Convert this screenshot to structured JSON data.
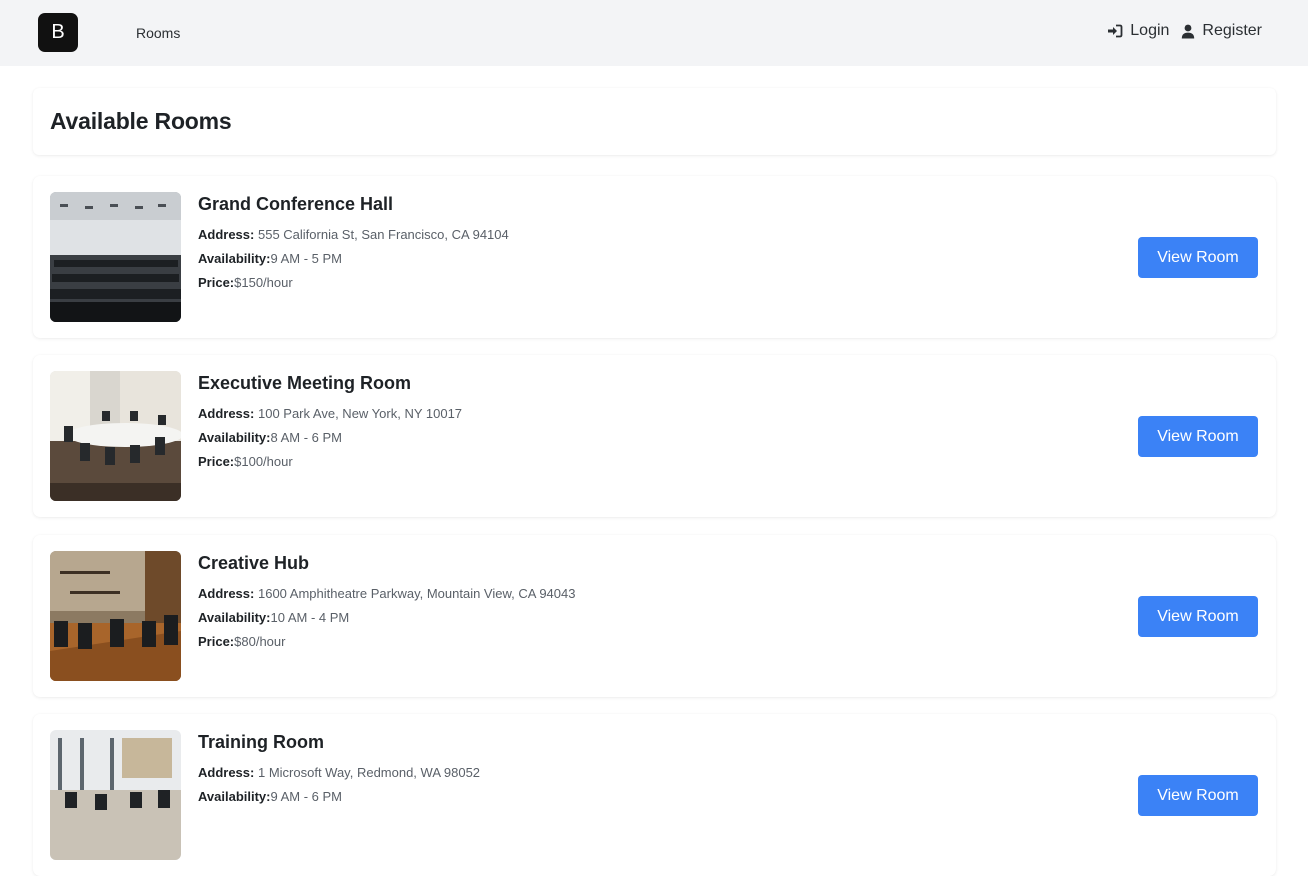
{
  "navbar": {
    "brand_letter": "B",
    "rooms_link": "Rooms",
    "login_label": "Login",
    "register_label": "Register"
  },
  "page": {
    "heading": "Available Rooms"
  },
  "labels": {
    "address": "Address:",
    "availability": "Availability:",
    "price": "Price:",
    "view_button": "View Room"
  },
  "rooms": [
    {
      "name": "Grand Conference Hall",
      "address": "555 California St, San Francisco, CA 94104",
      "availability": "9 AM - 5 PM",
      "price": "$150/hour"
    },
    {
      "name": "Executive Meeting Room",
      "address": "100 Park Ave, New York, NY 10017",
      "availability": "8 AM - 6 PM",
      "price": "$100/hour"
    },
    {
      "name": "Creative Hub",
      "address": "1600 Amphitheatre Parkway, Mountain View, CA 94043",
      "availability": "10 AM - 4 PM",
      "price": "$80/hour"
    },
    {
      "name": "Training Room",
      "address": "1 Microsoft Way, Redmond, WA 98052",
      "availability": "9 AM - 6 PM",
      "price": ""
    }
  ],
  "colors": {
    "accent": "#3b82f6",
    "navbar_bg": "#f3f4f6",
    "brand_bg": "#111111"
  },
  "icons": {
    "login": "sign-in-icon",
    "register": "user-icon"
  }
}
